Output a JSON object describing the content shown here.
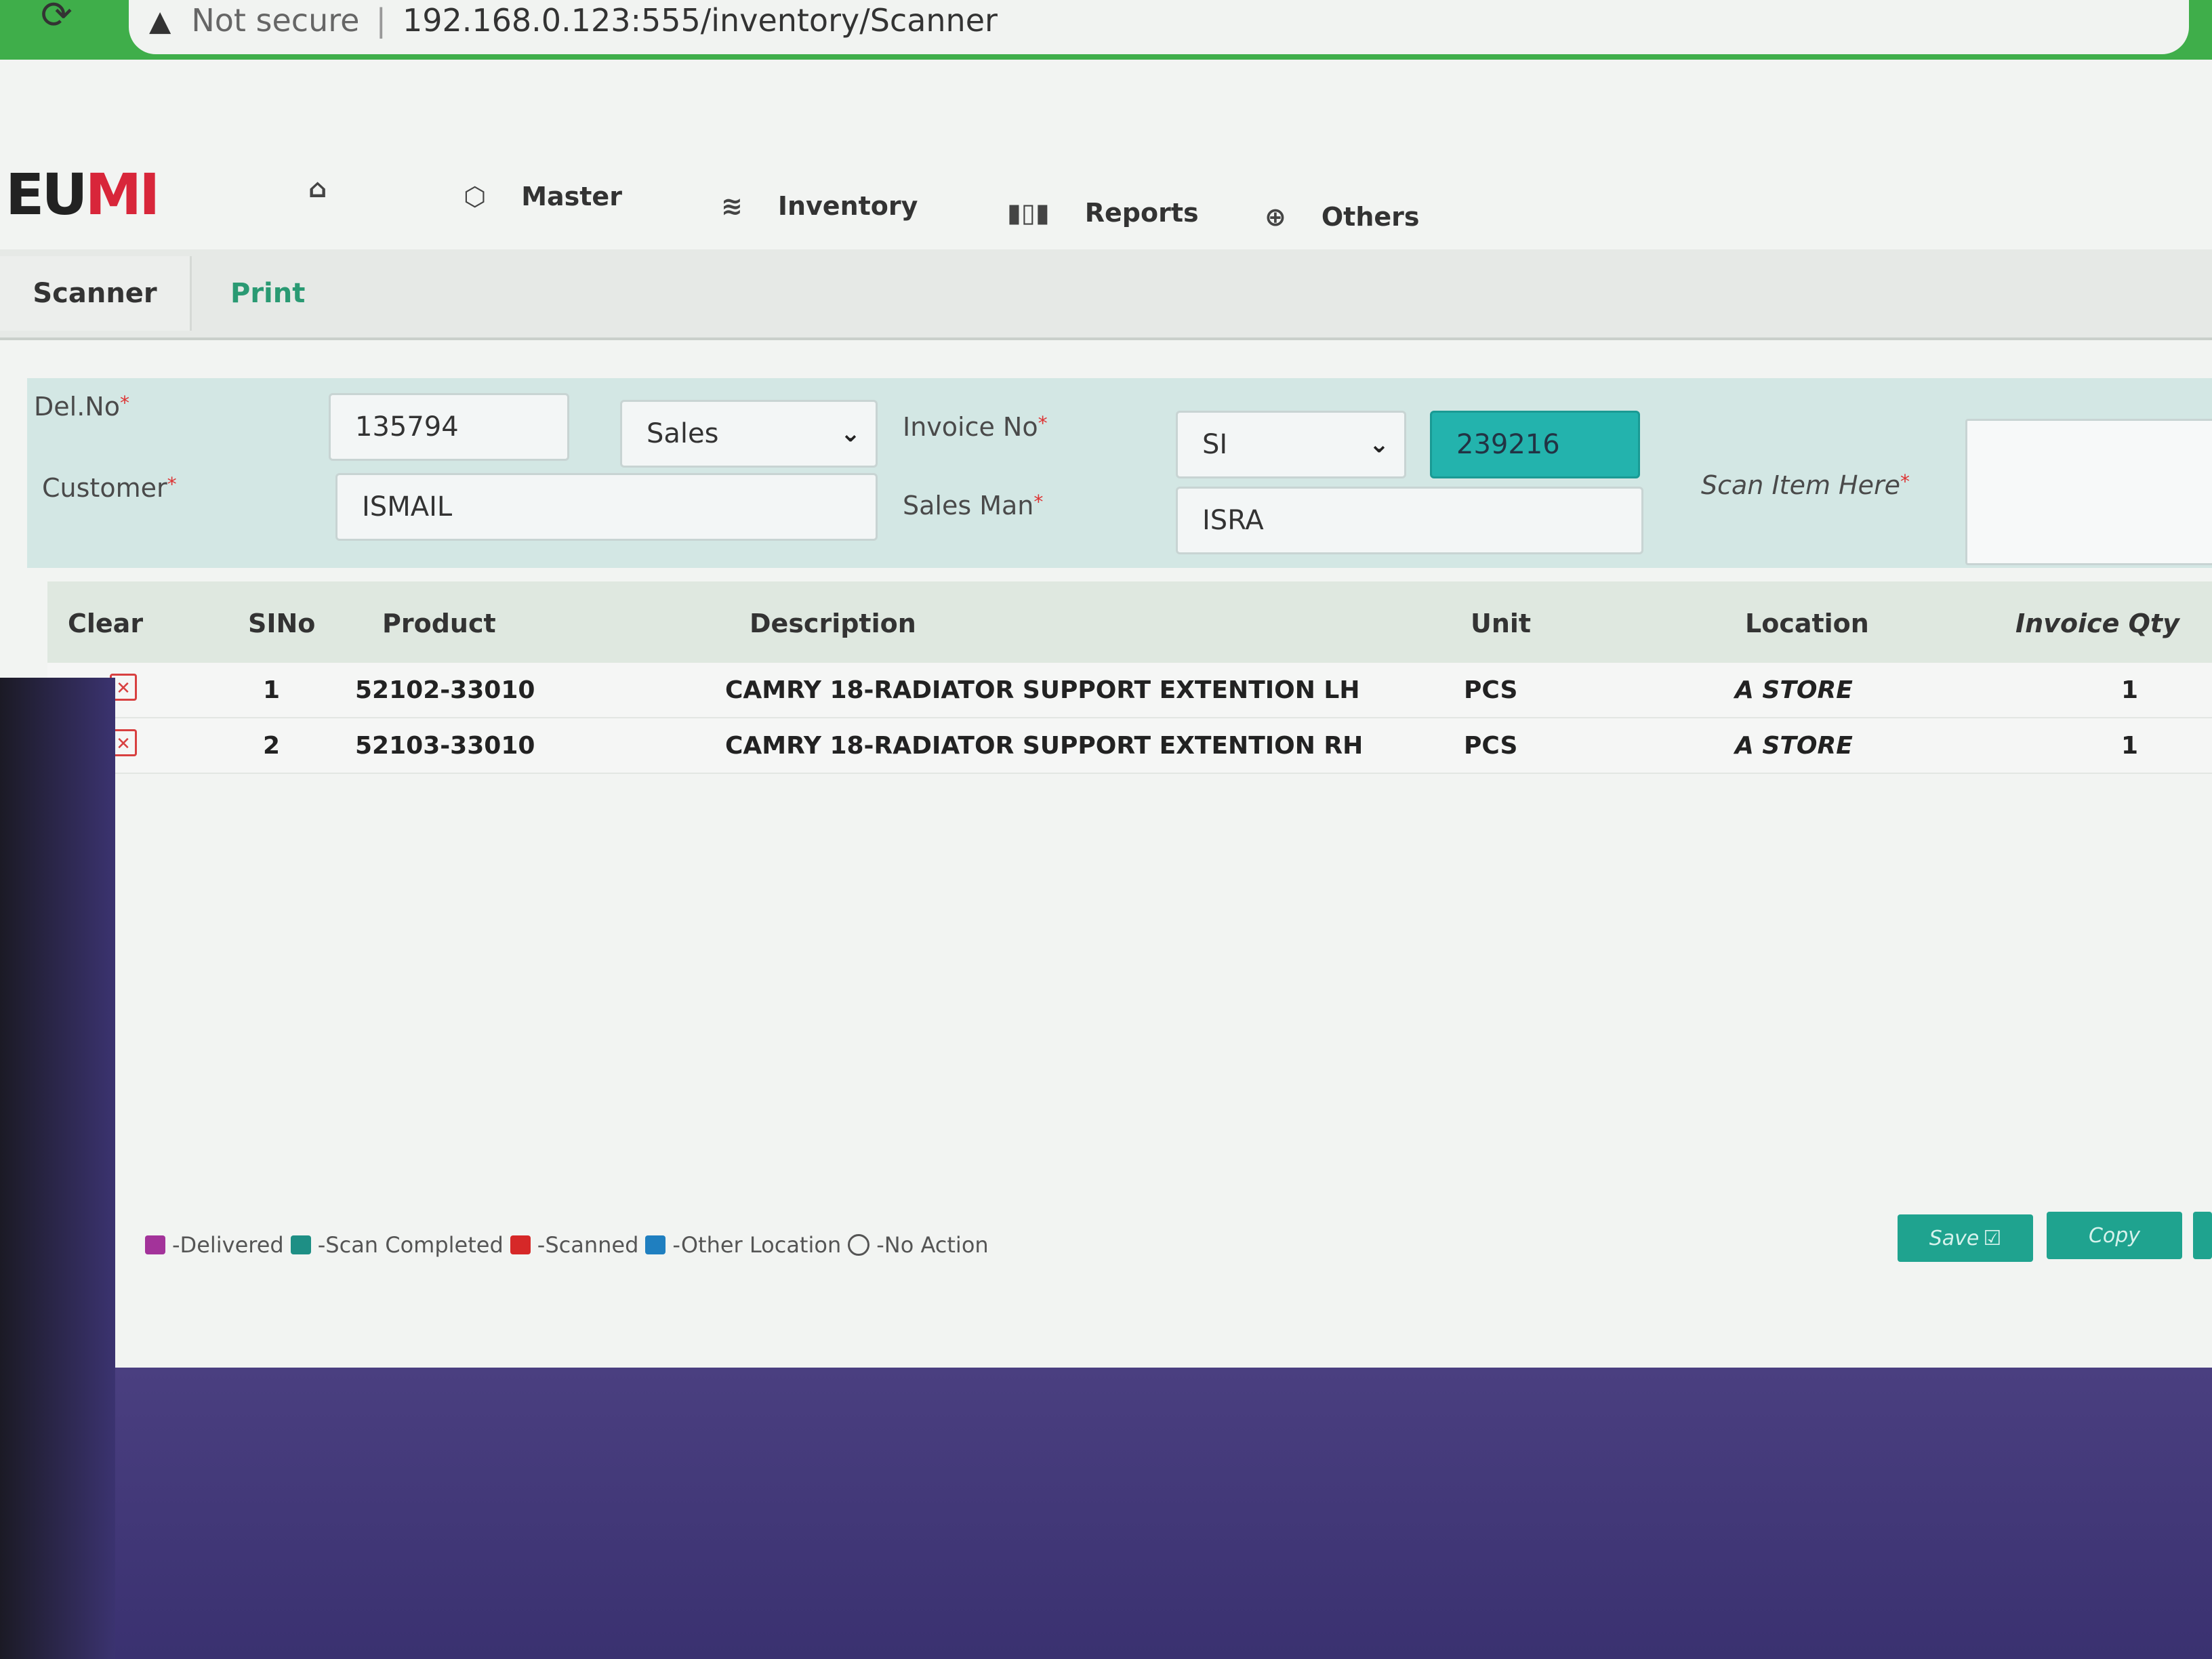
{
  "browser": {
    "reload_icon": "reload-icon",
    "warning_icon": "warning-icon",
    "not_secure": "Not secure",
    "url": "192.168.0.123:555/inventory/Scanner"
  },
  "logo": {
    "part1": "EU",
    "part2": "MI"
  },
  "nav": {
    "home_icon": "home-icon",
    "master": "Master",
    "inventory": "Inventory",
    "reports": "Reports",
    "others": "Others"
  },
  "tabs": {
    "scanner": "Scanner",
    "print": "Print"
  },
  "form": {
    "del_no_label": "Del.No",
    "del_no_value": "135794",
    "type_select": "Sales",
    "invoice_no_label": "Invoice No",
    "invoice_prefix": "SI",
    "invoice_number": "239216",
    "customer_label": "Customer",
    "customer_value": "ISMAIL",
    "salesman_label": "Sales Man",
    "salesman_value": "ISRA",
    "scan_label": "Scan Item Here",
    "required_mark": "*"
  },
  "table": {
    "headers": {
      "clear": "Clear",
      "sino": "SINo",
      "product": "Product",
      "description": "Description",
      "unit": "Unit",
      "location": "Location",
      "invoice_qty": "Invoice Qty"
    },
    "rows": [
      {
        "sino": "1",
        "product": "52102-33010",
        "description": "CAMRY 18-RADIATOR SUPPORT EXTENTION LH",
        "unit": "PCS",
        "location": "A STORE",
        "qty": "1"
      },
      {
        "sino": "2",
        "product": "52103-33010",
        "description": "CAMRY 18-RADIATOR SUPPORT EXTENTION RH",
        "unit": "PCS",
        "location": "A STORE",
        "qty": "1"
      }
    ]
  },
  "legend": {
    "delivered": "-Delivered",
    "scan_completed": "-Scan Completed",
    "scanned": "-Scanned",
    "other_location": "-Other Location",
    "no_action": "-No Action",
    "colors": {
      "delivered": "#a3339a",
      "scan_completed": "#1e8f85",
      "scanned": "#d62828",
      "other_location": "#1f7fc0"
    }
  },
  "actions": {
    "save": "Save",
    "copy": "Copy"
  }
}
